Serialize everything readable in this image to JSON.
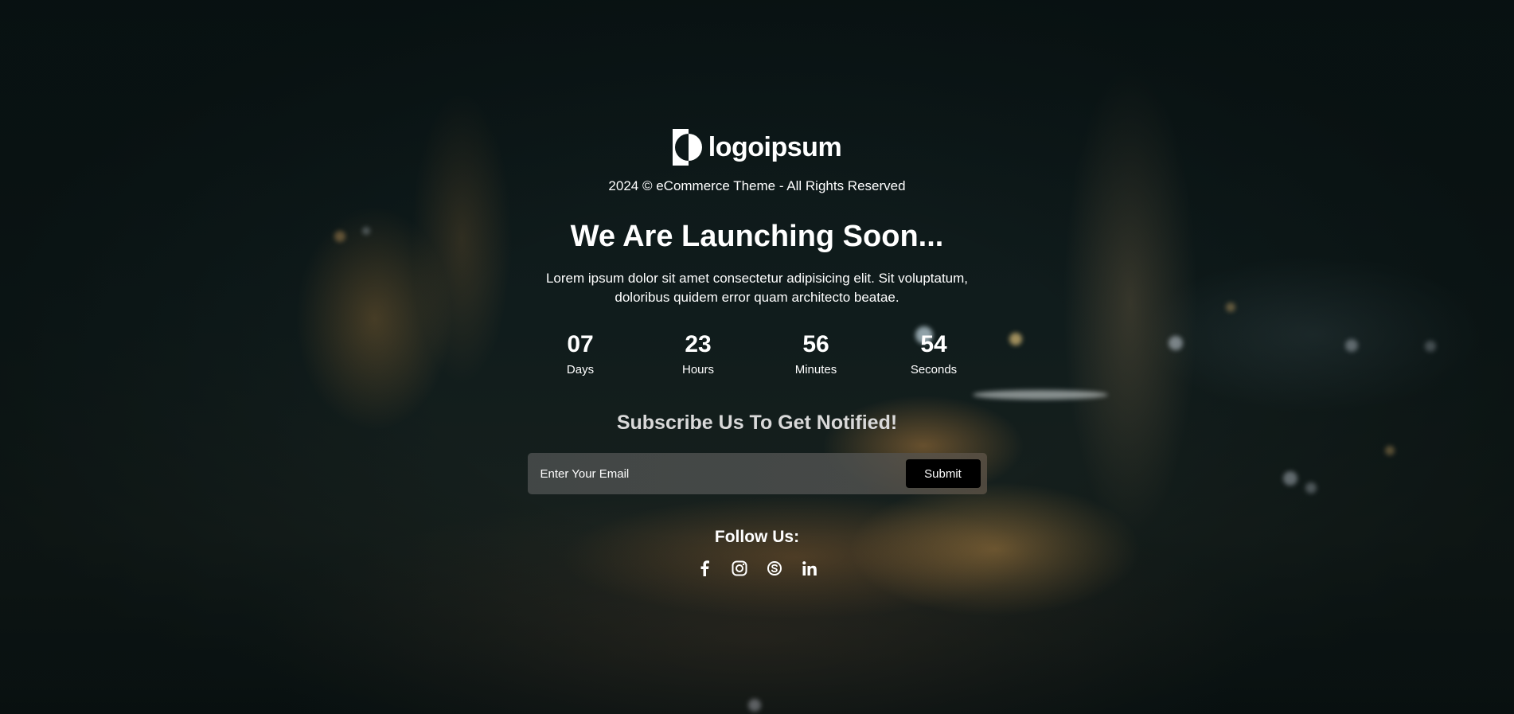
{
  "brand": {
    "logo_text": "logoipsum",
    "logo_icon": "logoipsum-mark-icon"
  },
  "copyright": "2024 © eCommerce Theme - All Rights Reserved",
  "hero": {
    "headline": "We Are Launching Soon...",
    "description": "Lorem ipsum dolor sit amet consectetur adipisicing elit. Sit voluptatum, doloribus quidem error quam architecto beatae."
  },
  "countdown": [
    {
      "value": "07",
      "label": "Days"
    },
    {
      "value": "23",
      "label": "Hours"
    },
    {
      "value": "56",
      "label": "Minutes"
    },
    {
      "value": "54",
      "label": "Seconds"
    }
  ],
  "subscribe": {
    "title": "Subscribe Us To Get Notified!",
    "email_placeholder": "Enter Your Email",
    "email_value": "",
    "submit_label": "Submit"
  },
  "follow": {
    "title": "Follow Us:",
    "socials": [
      {
        "name": "facebook",
        "icon": "facebook-icon"
      },
      {
        "name": "instagram",
        "icon": "instagram-icon"
      },
      {
        "name": "skype",
        "icon": "skype-icon"
      },
      {
        "name": "linkedin",
        "icon": "linkedin-icon"
      }
    ]
  },
  "colors": {
    "text": "#ffffff",
    "subscribe_title": "#d9d9d9",
    "button_bg": "#000000",
    "background": "#0d1819"
  }
}
